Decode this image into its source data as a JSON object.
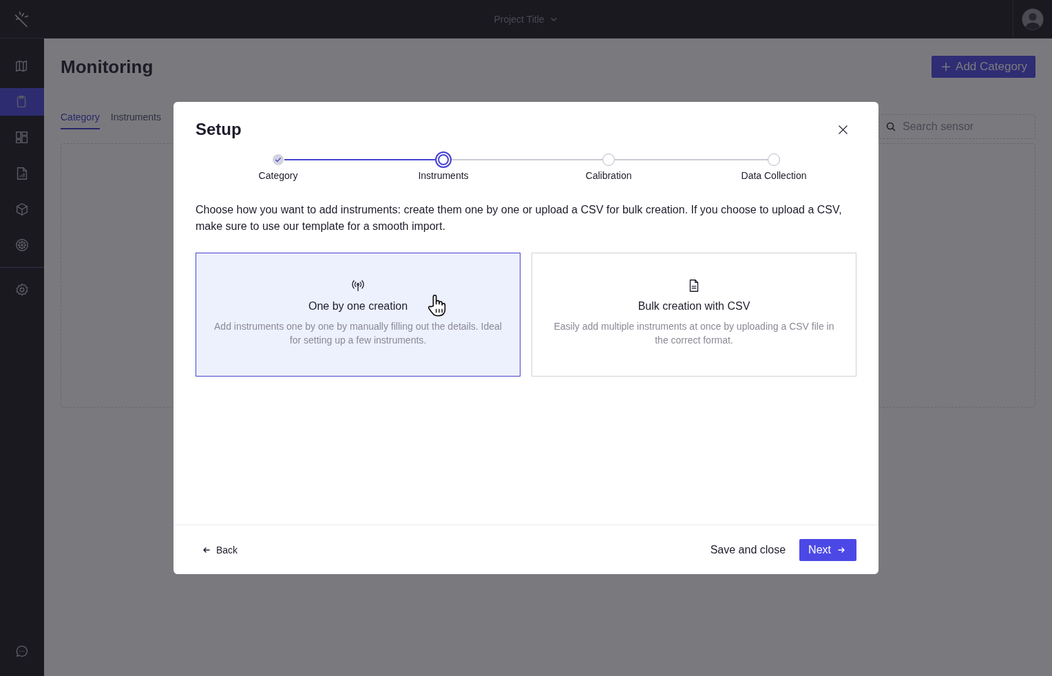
{
  "top_bar": {
    "project_title": "Project Title"
  },
  "sidebar": {
    "items": [
      {
        "kind": "map",
        "selected": false
      },
      {
        "kind": "clipboard",
        "selected": true
      },
      {
        "kind": "dashboard",
        "selected": false
      },
      {
        "kind": "report",
        "selected": false
      },
      {
        "kind": "cube",
        "selected": false
      },
      {
        "kind": "reel",
        "selected": false
      }
    ],
    "bottom_items": [
      {
        "kind": "settings",
        "selected": false
      }
    ],
    "footer_items": [
      {
        "kind": "chat",
        "selected": false
      }
    ]
  },
  "page": {
    "title": "Monitoring",
    "add_button": "Add Category",
    "tabs": [
      {
        "label": "Category",
        "selected": true
      },
      {
        "label": "Instruments",
        "selected": false
      }
    ],
    "search": {
      "placeholder": "Search sensor"
    }
  },
  "modal": {
    "title": "Setup",
    "steps": [
      {
        "label": "Category",
        "completed": true,
        "selected": false
      },
      {
        "label": "Instruments",
        "completed": false,
        "selected": true
      },
      {
        "label": "Calibration",
        "completed": false,
        "selected": false
      },
      {
        "label": "Data Collection",
        "completed": false,
        "selected": false
      }
    ],
    "description": "Choose how you want to add instruments: create them one by one or upload a CSV for bulk creation. If you choose to upload a CSV, make sure to use our template for a smooth import.",
    "options": [
      {
        "kind": "antenna",
        "title": "One by one creation",
        "description": "Add instruments one by one by manually filling out the details. Ideal for setting up a few instruments.",
        "selected": true
      },
      {
        "kind": "document",
        "title": "Bulk creation with CSV",
        "description": "Easily add multiple instruments at once by uploading a CSV file in the correct format.",
        "selected": false
      }
    ],
    "back_button": "Back",
    "save_button": "Save and close",
    "next_button": "Next"
  }
}
